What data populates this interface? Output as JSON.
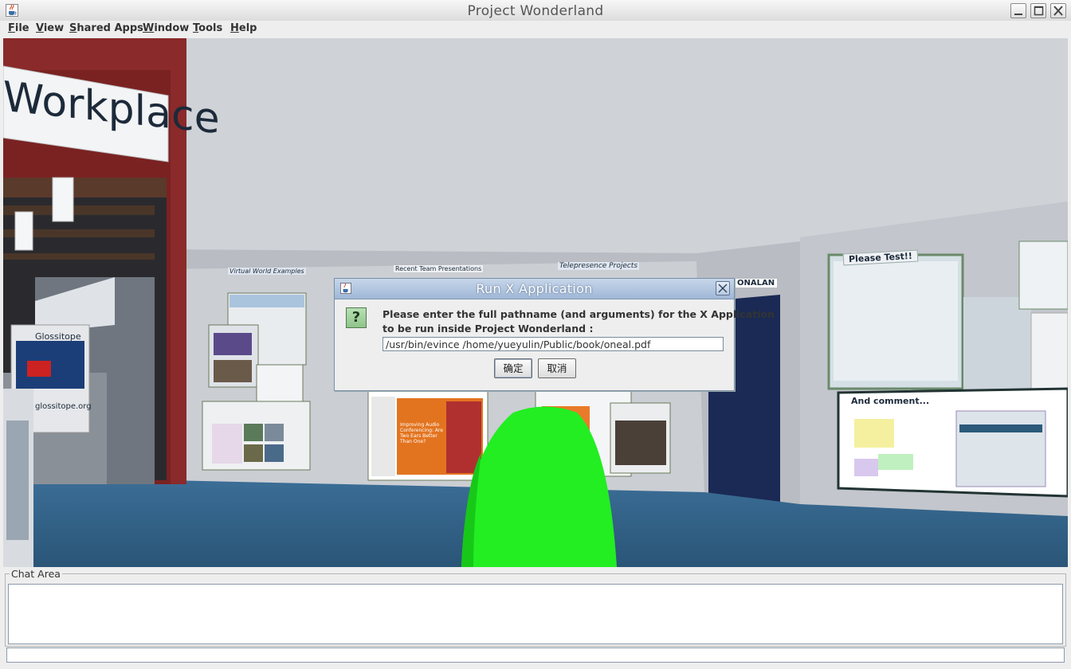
{
  "window": {
    "title": "Project Wonderland",
    "icon": "java-cup-icon"
  },
  "menu": [
    {
      "label": "File",
      "mnemonic": "F",
      "rest": "ile"
    },
    {
      "label": "View",
      "mnemonic": "V",
      "rest": "iew"
    },
    {
      "label": "Shared Apps",
      "mnemonic": "S",
      "rest": "hared Apps"
    },
    {
      "label": "Window",
      "mnemonic": "W",
      "rest": "indow"
    },
    {
      "label": "Tools",
      "mnemonic": "T",
      "rest": "ools"
    },
    {
      "label": "Help",
      "mnemonic": "H",
      "rest": "elp"
    }
  ],
  "scene": {
    "workplace_sign": "Workplace",
    "glossitope_title": "Glossitope",
    "glossitope_url": "glossitope.org",
    "virtual_world_label": "Virtual World Examples",
    "recent_team_label": "Recent Team Presentations",
    "telepresence_label": "Telepresence Projects",
    "onalan_label": "ONALAN",
    "please_test_label": "Please Test!!",
    "and_comment_label": "And comment...",
    "slide_title": "Improving Audio Conferencing: Are Two Ears Better Than One?"
  },
  "dialog": {
    "title": "Run X Application",
    "prompt_line1": "Please enter the full pathname (and arguments) for the X Application",
    "prompt_line2": "to be run inside Project Wonderland :",
    "input_value": "/usr/bin/evince /home/yueyulin/Public/book/oneal.pdf",
    "ok_label": "确定",
    "cancel_label": "取消",
    "icon": "question-icon"
  },
  "chat": {
    "legend": "Chat Area",
    "text": "",
    "input_value": ""
  },
  "colors": {
    "avatar": "#22ee22",
    "floor": "#2f5f86",
    "dialog_title_bar": "#a9bfdc"
  }
}
